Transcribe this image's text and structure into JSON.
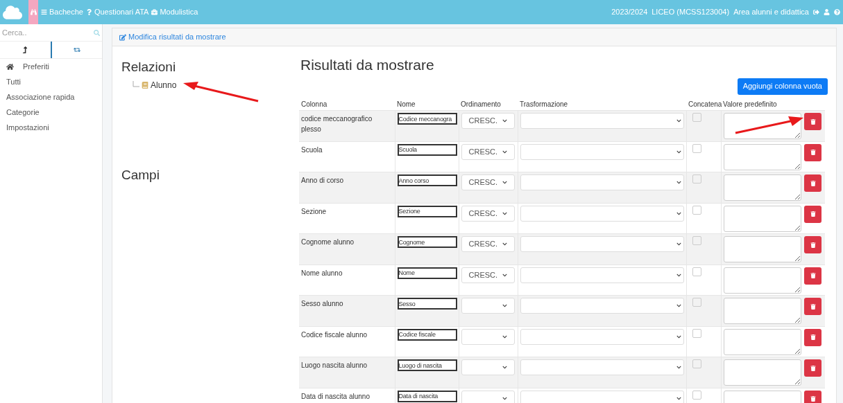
{
  "topbar": {
    "nav": [
      {
        "kind": "menu",
        "label": "Bacheche"
      },
      {
        "kind": "help",
        "label": "Questionari ATA"
      },
      {
        "kind": "briefcase",
        "label": "Modulistica"
      }
    ],
    "right": [
      "2023/2024",
      "LICEO (MCSS123004)",
      "Area alunni e didattica"
    ]
  },
  "sidebar": {
    "search": {
      "placeholder": "Cerca.."
    },
    "tabs": [
      {
        "kind": "up",
        "selected": true
      },
      {
        "kind": "repeat",
        "selected": false
      }
    ],
    "items": [
      {
        "label": "Preferiti",
        "kind": "home"
      },
      {
        "label": "Tutti",
        "kind": "plain"
      },
      {
        "label": "Associazione rapida",
        "kind": "plain"
      },
      {
        "label": "Categorie",
        "kind": "plain"
      },
      {
        "label": "Impostazioni",
        "kind": "plain"
      }
    ]
  },
  "panel": {
    "title": "Modifica risultati da mostrare",
    "relations_title": "Relazioni",
    "relations": [
      {
        "label": "Alunno"
      }
    ],
    "fields_title": "Campi",
    "results_title": "Risultati da mostrare",
    "add_button": "Aggiungi colonna vuota",
    "columns": [
      "Colonna",
      "Nome",
      "Ordinamento",
      "Trasformazione",
      "Concatena",
      "Valore predefinito"
    ],
    "rows": [
      {
        "column": "codice meccanografico plesso",
        "name": "Codice meccanogra",
        "order": "CRESC.",
        "concat": false
      },
      {
        "column": "Scuola",
        "name": "Scuola",
        "order": "CRESC.",
        "concat": false
      },
      {
        "column": "Anno di corso",
        "name": "Anno corso",
        "order": "CRESC.",
        "concat": false
      },
      {
        "column": "Sezione",
        "name": "Sezione",
        "order": "CRESC.",
        "concat": false
      },
      {
        "column": "Cognome alunno",
        "name": "Cognome",
        "order": "CRESC.",
        "concat": false
      },
      {
        "column": "Nome alunno",
        "name": "Nome",
        "order": "CRESC.",
        "concat": false
      },
      {
        "column": "Sesso alunno",
        "name": "Sesso",
        "concat": false
      },
      {
        "column": "Codice fiscale alunno",
        "name": "Codice fiscale",
        "concat": false
      },
      {
        "column": "Luogo nascita alunno",
        "name": "Luogo di nascita",
        "concat": false
      },
      {
        "column": "Data di nascita alunno",
        "name": "Data di nascita",
        "concat": false
      }
    ]
  },
  "callout_arrows": {
    "to_relation": true,
    "to_delete": true
  }
}
